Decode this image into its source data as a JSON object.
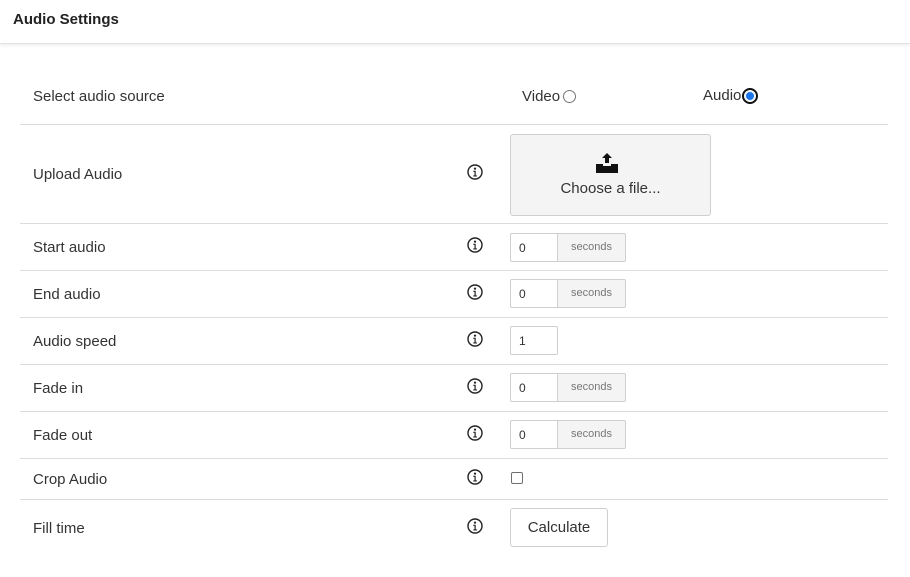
{
  "header": {
    "title": "Audio Settings"
  },
  "source": {
    "label": "Select audio source",
    "options": [
      {
        "label": "Video",
        "checked": false
      },
      {
        "label": "Audio",
        "checked": true
      }
    ]
  },
  "upload": {
    "label": "Upload Audio",
    "button_text": "Choose a file..."
  },
  "start": {
    "label": "Start audio",
    "value": "0",
    "unit": "seconds"
  },
  "end": {
    "label": "End audio",
    "value": "0",
    "unit": "seconds"
  },
  "speed": {
    "label": "Audio speed",
    "value": "1"
  },
  "fade_in": {
    "label": "Fade in",
    "value": "0",
    "unit": "seconds"
  },
  "fade_out": {
    "label": "Fade out",
    "value": "0",
    "unit": "seconds"
  },
  "crop": {
    "label": "Crop Audio",
    "checked": false
  },
  "fill": {
    "label": "Fill time",
    "button_text": "Calculate"
  },
  "colors": {
    "radio_selected": "#1a73e8",
    "border": "#dcdcdc",
    "addon_bg": "#f4f4f4"
  }
}
